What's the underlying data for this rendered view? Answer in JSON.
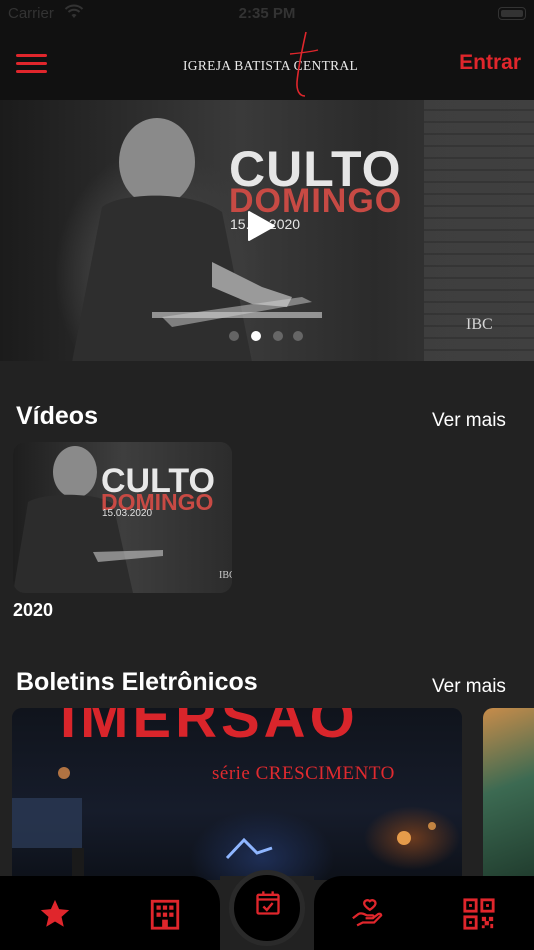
{
  "status_bar": {
    "carrier": "Carrier",
    "time": "2:35 PM"
  },
  "header": {
    "logo_text": "IGREJA BATISTA CENTRAL",
    "login_label": "Entrar"
  },
  "hero": {
    "title_line1": "CULTO",
    "title_line2": "DOMINGO",
    "date": "15.03.2020",
    "brand": "IBC",
    "slides_count": 4,
    "active_slide": 1
  },
  "videos": {
    "title": "Vídeos",
    "see_more": "Ver mais",
    "items": [
      {
        "thumb_title1": "CULTO",
        "thumb_title2": "DOMINGO",
        "thumb_date": "15.03.2020",
        "thumb_brand": "IBC",
        "label": "2020"
      }
    ]
  },
  "bulletins": {
    "title": "Boletins Eletrônicos",
    "see_more": "Ver mais",
    "items": [
      {
        "big_text": "IMERSÃO",
        "series": "série CRESCIMENTO"
      },
      {
        "big_text": "",
        "series": ""
      }
    ]
  },
  "tabbar": {
    "tabs": [
      "star-icon",
      "building-icon",
      "calendar-check-icon",
      "heart-hand-icon",
      "qr-code-icon"
    ]
  },
  "colors": {
    "accent": "#e0262c",
    "background": "#222222",
    "header": "#111111",
    "tabbar": "#000000"
  }
}
